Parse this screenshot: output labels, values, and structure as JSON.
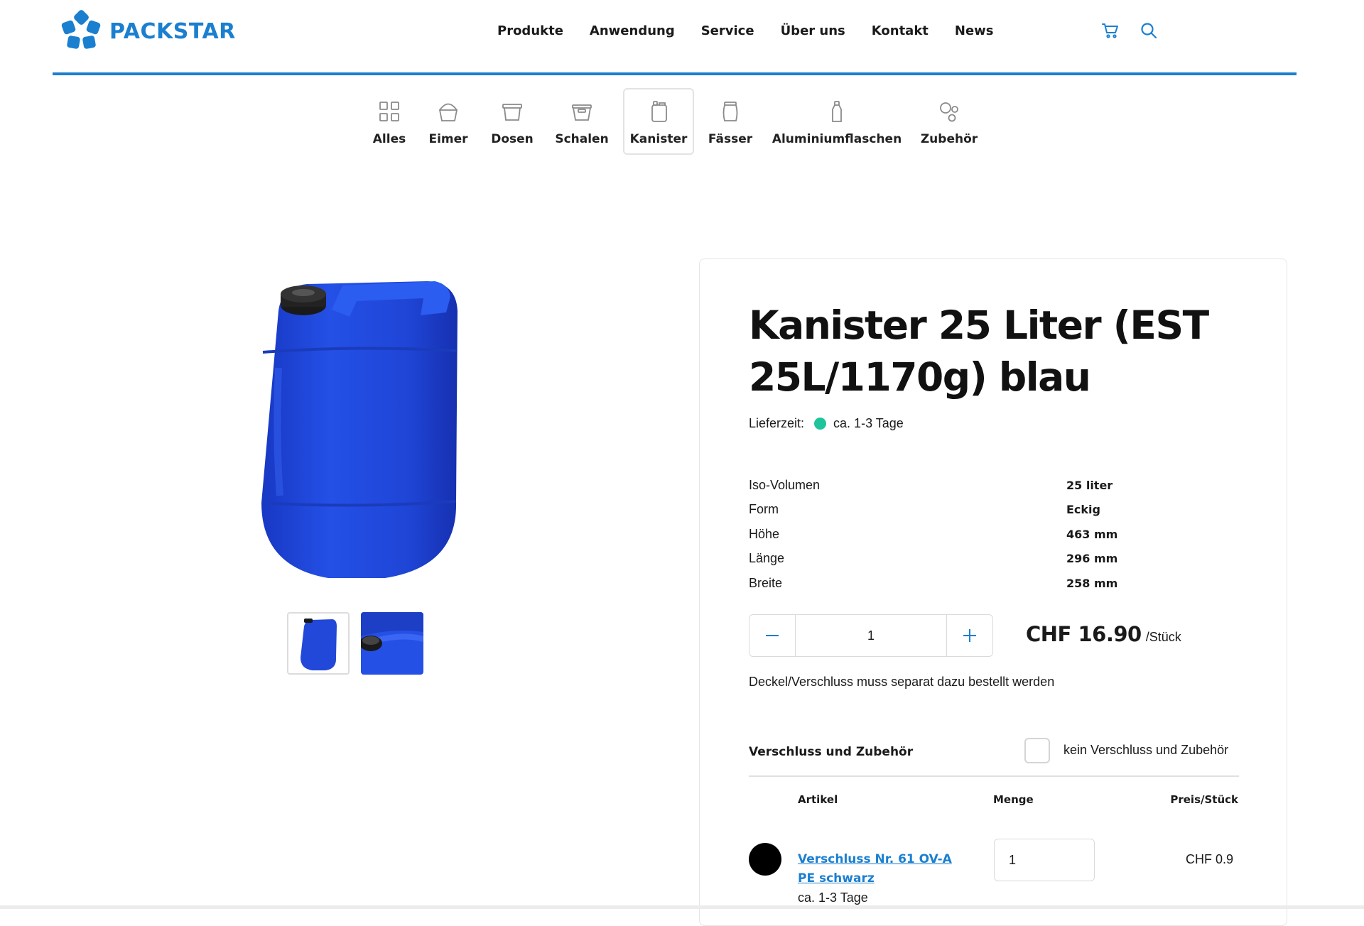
{
  "brand": {
    "name": "PACKSTAR",
    "color": "#1b7fd0"
  },
  "nav": {
    "items": [
      "Produkte",
      "Anwendung",
      "Service",
      "Über uns",
      "Kontakt",
      "News"
    ]
  },
  "header_icons": [
    "cart-icon",
    "search-icon"
  ],
  "categories": [
    {
      "label": "Alles",
      "icon": "grid-icon"
    },
    {
      "label": "Eimer",
      "icon": "bucket-icon"
    },
    {
      "label": "Dosen",
      "icon": "can-icon"
    },
    {
      "label": "Schalen",
      "icon": "tray-icon"
    },
    {
      "label": "Kanister",
      "icon": "canister-icon",
      "active": true
    },
    {
      "label": "Fässer",
      "icon": "barrel-icon"
    },
    {
      "label": "Aluminiumflaschen",
      "icon": "bottle-icon"
    },
    {
      "label": "Zubehör",
      "icon": "accessories-icon"
    }
  ],
  "product": {
    "title": "Kanister 25 Liter (EST 25L/1170g) blau",
    "delivery_label": "Lieferzeit:",
    "delivery_value": "ca. 1-3 Tage",
    "delivery_status_color": "#1ec49a",
    "specs": [
      {
        "label": "Iso-Volumen",
        "value": "25 liter"
      },
      {
        "label": "Form",
        "value": "Eckig"
      },
      {
        "label": "Höhe",
        "value": "463 mm"
      },
      {
        "label": "Länge",
        "value": "296 mm"
      },
      {
        "label": "Breite",
        "value": "258 mm"
      }
    ],
    "quantity": "1",
    "price": "CHF 16.90",
    "price_unit": "/Stück",
    "note": "Deckel/Verschluss muss separat dazu bestellt werden",
    "image_color": "#1f45d6"
  },
  "accessories": {
    "title": "Verschluss und Zubehör",
    "checkbox_label": "kein Verschluss und Zubehör",
    "headers": {
      "artikel": "Artikel",
      "menge": "Menge",
      "preis": "Preis/Stück"
    },
    "rows": [
      {
        "name": "Verschluss Nr. 61 OV-A PE schwarz",
        "delivery": "ca. 1-3 Tage",
        "quantity": "1",
        "price": "CHF 0.9",
        "swatch": "#000000"
      }
    ]
  }
}
